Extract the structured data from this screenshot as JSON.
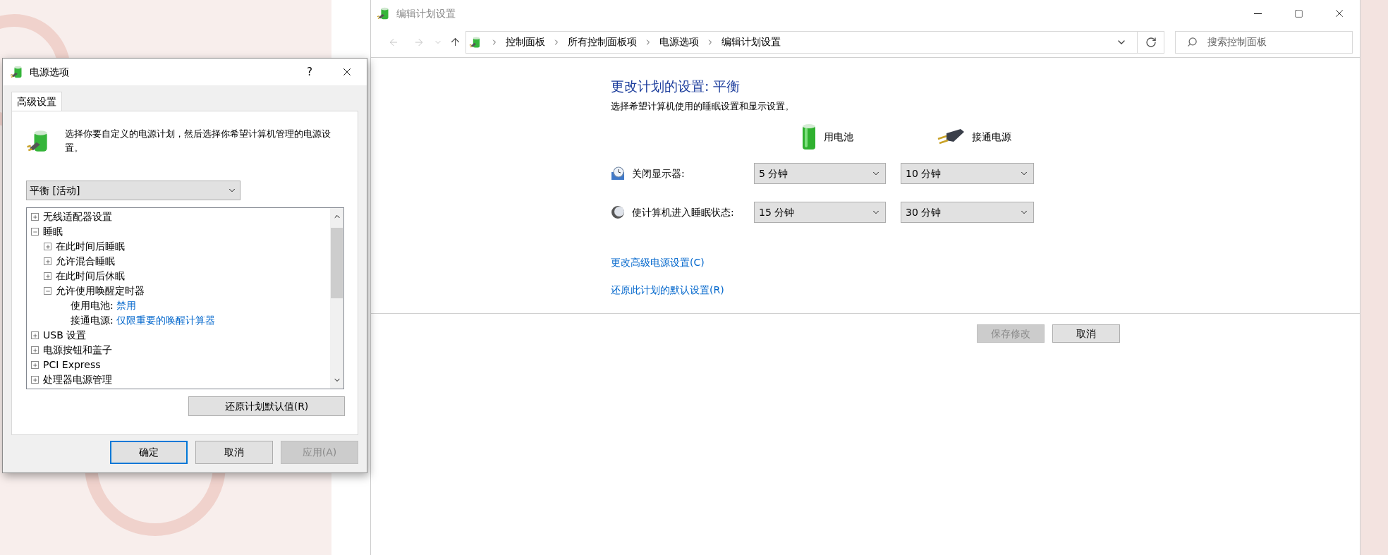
{
  "edit_window": {
    "title": "编辑计划设置",
    "breadcrumb": [
      "控制面板",
      "所有控制面板项",
      "电源选项",
      "编辑计划设置"
    ],
    "search": {
      "placeholder": "搜索控制面板"
    },
    "heading": "更改计划的设置: 平衡",
    "subtitle": "选择希望计算机使用的睡眠设置和显示设置。",
    "columns": [
      {
        "label": "用电池",
        "kind": "battery"
      },
      {
        "label": "接通电源",
        "kind": "plug"
      }
    ],
    "settings": [
      {
        "label": "关闭显示器:",
        "kind": "display",
        "values": [
          "5 分钟",
          "10 分钟"
        ]
      },
      {
        "label": "使计算机进入睡眠状态:",
        "kind": "sleep",
        "values": [
          "15 分钟",
          "30 分钟"
        ]
      }
    ],
    "links": [
      "更改高级电源设置(C)",
      "还原此计划的默认设置(R)"
    ],
    "buttons": [
      {
        "label": "保存修改",
        "disabled": true
      },
      {
        "label": "取消",
        "disabled": false
      }
    ]
  },
  "power_dialog": {
    "title": "电源选项",
    "help": "?",
    "tabs": [
      {
        "label": "高级设置",
        "selected": true
      }
    ],
    "description": "选择你要自定义的电源计划，然后选择你希望计算机管理的电源设置。",
    "plan": "平衡 [活动]",
    "tree": [
      {
        "kind": "group",
        "label": "无线适配器设置",
        "expanded": false
      },
      {
        "kind": "group",
        "label": "睡眠",
        "expanded": true,
        "children": [
          {
            "kind": "group",
            "label": "在此时间后睡眠",
            "expanded": false
          },
          {
            "kind": "group",
            "label": "允许混合睡眠",
            "expanded": false
          },
          {
            "kind": "group",
            "label": "在此时间后休眠",
            "expanded": false
          },
          {
            "kind": "group",
            "label": "允许使用唤醒定时器",
            "expanded": true,
            "children": [
              {
                "kind": "setting",
                "label": "使用电池:",
                "value": "禁用"
              },
              {
                "kind": "setting",
                "label": "接通电源:",
                "value": "仅限重要的唤醒计算器"
              }
            ]
          }
        ]
      },
      {
        "kind": "group",
        "label": "USB 设置",
        "expanded": false
      },
      {
        "kind": "group",
        "label": "电源按钮和盖子",
        "expanded": false
      },
      {
        "kind": "group",
        "label": "PCI Express",
        "expanded": false
      },
      {
        "kind": "group",
        "label": "处理器电源管理",
        "expanded": false
      }
    ],
    "restore_button": "还原计划默认值(R)",
    "buttons": [
      {
        "label": "确定",
        "default": true,
        "disabled": false
      },
      {
        "label": "取消",
        "default": false,
        "disabled": false
      },
      {
        "label": "应用(A)",
        "default": false,
        "disabled": true
      }
    ]
  }
}
